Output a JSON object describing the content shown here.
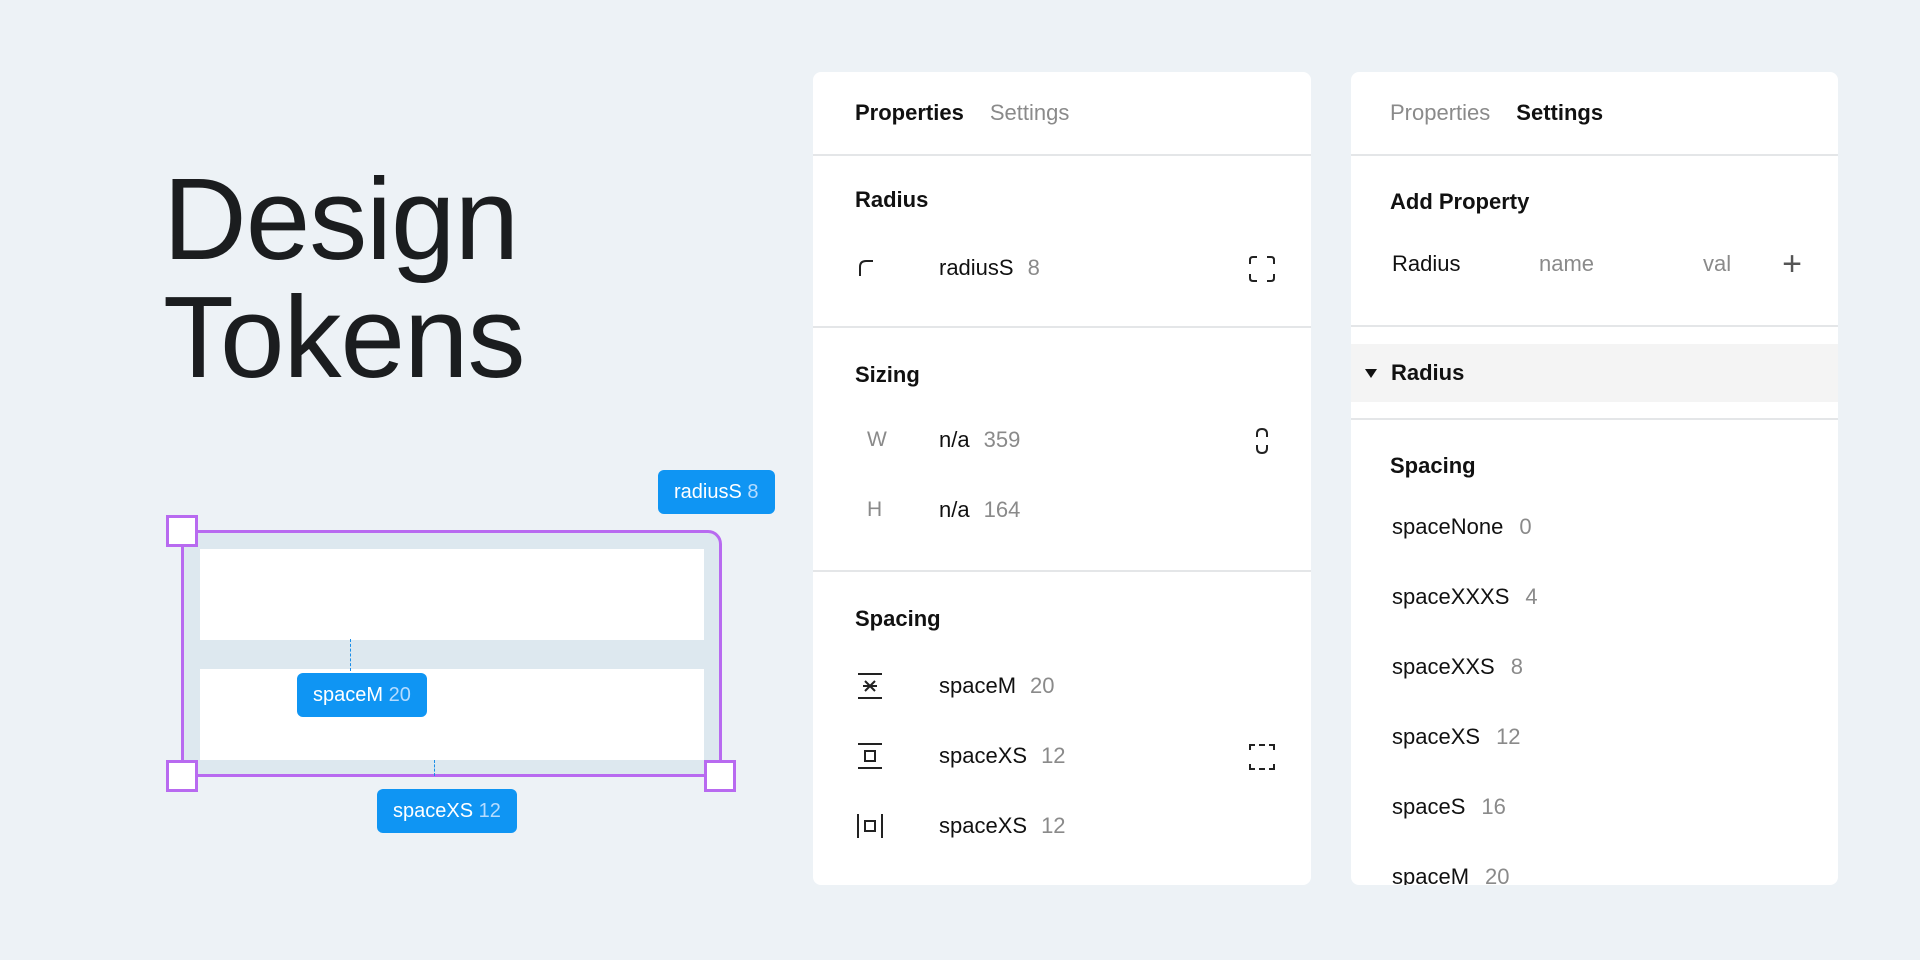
{
  "hero": {
    "line1": "Design",
    "line2": "Tokens"
  },
  "canvas": {
    "radius_token": {
      "name": "radiusS",
      "value": "8"
    },
    "gap_token": {
      "name": "spaceM",
      "value": "20"
    },
    "padding_token": {
      "name": "spaceXS",
      "value": "12"
    }
  },
  "properties_panel": {
    "tabs": [
      {
        "label": "Properties",
        "active": true
      },
      {
        "label": "Settings",
        "active": false
      }
    ],
    "radius": {
      "title": "Radius",
      "row": {
        "icon": "corner-radius-icon",
        "name": "radiusS",
        "value": "8",
        "right_icon": "independent-corners-icon"
      }
    },
    "sizing": {
      "title": "Sizing",
      "rows": [
        {
          "axis": "W",
          "name": "n/a",
          "value": "359"
        },
        {
          "axis": "H",
          "name": "n/a",
          "value": "164"
        }
      ],
      "link_icon": "constrain-proportions-icon"
    },
    "spacing": {
      "title": "Spacing",
      "rows": [
        {
          "icon": "vertical-gap-icon",
          "name": "spaceM",
          "value": "20"
        },
        {
          "icon": "vertical-padding-icon",
          "name": "spaceXS",
          "value": "12"
        },
        {
          "icon": "horizontal-padding-icon",
          "name": "spaceXS",
          "value": "12"
        }
      ],
      "right_icon": "individual-padding-icon"
    }
  },
  "settings_panel": {
    "tabs": [
      {
        "label": "Properties",
        "active": false
      },
      {
        "label": "Settings",
        "active": true
      }
    ],
    "add_property": {
      "title": "Add Property",
      "type": "Radius",
      "name_placeholder": "name",
      "value_placeholder": "val",
      "add_icon": "plus-icon"
    },
    "radius_group": {
      "label": "Radius",
      "expanded": false
    },
    "spacing_group": {
      "title": "Spacing",
      "items": [
        {
          "name": "spaceNone",
          "value": "0"
        },
        {
          "name": "spaceXXXS",
          "value": "4"
        },
        {
          "name": "spaceXXS",
          "value": "8"
        },
        {
          "name": "spaceXS",
          "value": "12"
        },
        {
          "name": "spaceS",
          "value": "16"
        },
        {
          "name": "spaceM",
          "value": "20"
        }
      ]
    }
  },
  "colors": {
    "accent": "#0f95f3",
    "selection": "#b86af0",
    "background": "#edf2f6"
  }
}
